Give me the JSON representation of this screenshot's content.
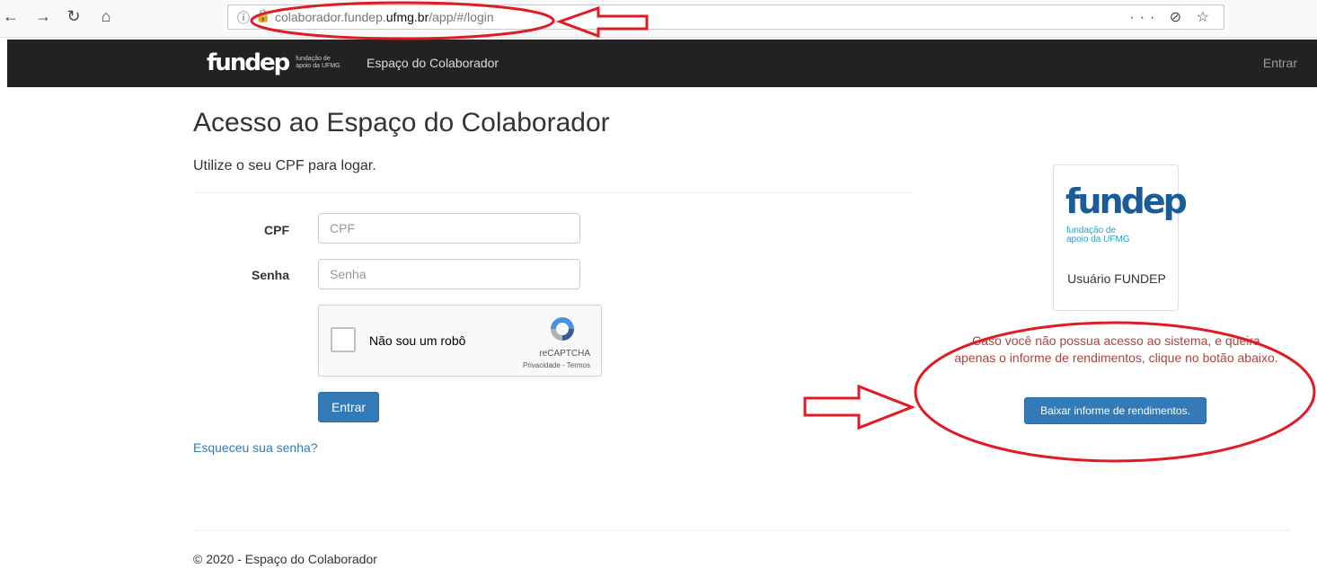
{
  "browser": {
    "url_prefix": "colaborador.fundep.",
    "url_domain": "ufmg.br",
    "url_suffix": "/app/#/login",
    "actions": "··· ⊘ ☆"
  },
  "navbar": {
    "brand_logo": "fundep",
    "brand_sub_line1": "fundação de",
    "brand_sub_line2": "apoio da UFMG",
    "title": "Espaço do Colaborador",
    "login_link": "Entrar"
  },
  "page": {
    "title": "Acesso ao Espaço do Colaborador",
    "subtitle": "Utilize o seu CPF para logar."
  },
  "form": {
    "cpf_label": "CPF",
    "cpf_placeholder": "CPF",
    "password_label": "Senha",
    "password_placeholder": "Senha",
    "captcha_label": "Não sou um robô",
    "captcha_brand": "reCAPTCHA",
    "captcha_links": "Privacidade - Termos",
    "submit_label": "Entrar",
    "forgot_label": "Esqueceu sua senha?"
  },
  "side": {
    "card_logo": "fundep",
    "card_logo_sub1": "fundação de",
    "card_logo_sub2": "apoio da UFMG",
    "card_caption": "Usuário FUNDEP",
    "notice": "Caso você não possua acesso ao sistema, e queira apenas o informe de rendimentos, clique no botão abaixo.",
    "download_label": "Baixar informe de rendimentos."
  },
  "footer": {
    "text": "© 2020 - Espaço do Colaborador"
  },
  "colors": {
    "primary": "#337ab7",
    "navbar": "#222222",
    "notice": "#a94442",
    "annotation": "#e01b24"
  }
}
